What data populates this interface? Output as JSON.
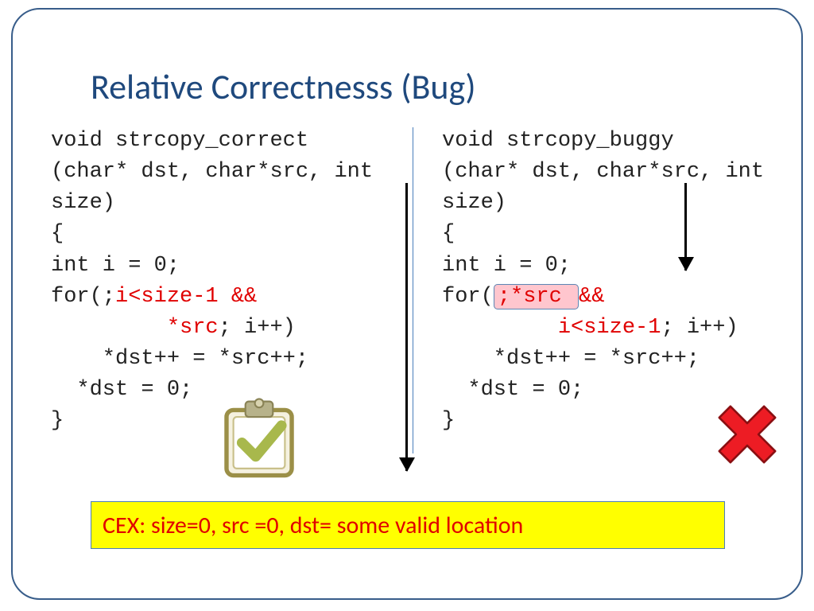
{
  "title": "Relative Correctnesss (Bug)",
  "left": {
    "l1": "void strcopy_correct",
    "l2": "(char* dst, char*src, int size)",
    "l3": "{",
    "l4a": "  int i = 0;",
    "l5a": "  for(;",
    "l5b": "i<size-1 &&",
    "l6a": "         *src",
    "l6b": "; i++)",
    "l7": "    *dst++ = *src++;",
    "l8": "  *dst = 0;",
    "l9": "}"
  },
  "right": {
    "l1": "void strcopy_buggy",
    "l2": "(char* dst, char*src, int size)",
    "l3": "{",
    "l4a": "  int i = 0;",
    "l5a": "  for(",
    "l5bug": ";*src ",
    "l5c": "&&",
    "l6a": "         i<size-1",
    "l6b": "; i++)",
    "l7": "    *dst++ = *src++;",
    "l8": "  *dst = 0;",
    "l9": "}"
  },
  "cex": "CEX: size=0, src =0, dst= some valid location"
}
